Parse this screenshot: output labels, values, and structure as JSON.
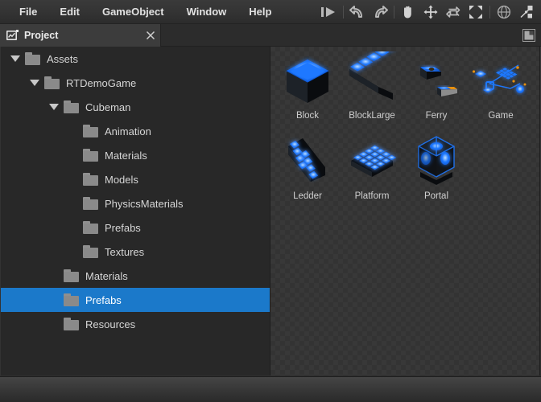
{
  "menubar": {
    "items": [
      {
        "label": "File"
      },
      {
        "label": "Edit"
      },
      {
        "label": "GameObject"
      },
      {
        "label": "Window"
      },
      {
        "label": "Help"
      }
    ],
    "toolbar": [
      {
        "name": "play-step-button",
        "icon": "play-step-icon"
      },
      {
        "name": "undo-button",
        "icon": "undo-icon"
      },
      {
        "name": "redo-button",
        "icon": "redo-icon"
      },
      {
        "name": "hand-tool-button",
        "icon": "hand-icon"
      },
      {
        "name": "move-tool-button",
        "icon": "move-arrows-icon"
      },
      {
        "name": "rotate-tool-button",
        "icon": "rotate-icon"
      },
      {
        "name": "scale-tool-button",
        "icon": "expand-arrows-icon"
      },
      {
        "name": "globe-button",
        "icon": "globe-icon"
      },
      {
        "name": "connect-button",
        "icon": "node-link-icon"
      }
    ]
  },
  "tabbar": {
    "tab_label": "Project",
    "tab_icon": "project-panel-icon",
    "close_icon": "close-icon",
    "panel_menu_icon": "panel-layout-icon"
  },
  "tree": {
    "items": [
      {
        "label": "Assets",
        "depth": 0,
        "expanded": true,
        "selected": false
      },
      {
        "label": "RTDemoGame",
        "depth": 1,
        "expanded": true,
        "selected": false
      },
      {
        "label": "Cubeman",
        "depth": 2,
        "expanded": true,
        "selected": false
      },
      {
        "label": "Animation",
        "depth": 3,
        "expanded": false,
        "selected": false
      },
      {
        "label": "Materials",
        "depth": 3,
        "expanded": false,
        "selected": false
      },
      {
        "label": "Models",
        "depth": 3,
        "expanded": false,
        "selected": false
      },
      {
        "label": "PhysicsMaterials",
        "depth": 3,
        "expanded": false,
        "selected": false
      },
      {
        "label": "Prefabs",
        "depth": 3,
        "expanded": false,
        "selected": false
      },
      {
        "label": "Textures",
        "depth": 3,
        "expanded": false,
        "selected": false
      },
      {
        "label": "Materials",
        "depth": 2,
        "expanded": false,
        "selected": false
      },
      {
        "label": "Prefabs",
        "depth": 2,
        "expanded": false,
        "selected": true
      },
      {
        "label": "Resources",
        "depth": 2,
        "expanded": false,
        "selected": false
      }
    ],
    "selection_color": "#1b79ca"
  },
  "grid": {
    "items": [
      {
        "label": "Block",
        "thumb": "block-cube-thumb"
      },
      {
        "label": "BlockLarge",
        "thumb": "block-large-thumb"
      },
      {
        "label": "Ferry",
        "thumb": "ferry-thumb"
      },
      {
        "label": "Game",
        "thumb": "game-scene-thumb"
      },
      {
        "label": "Ledder",
        "thumb": "ledder-thumb"
      },
      {
        "label": "Platform",
        "thumb": "platform-thumb"
      },
      {
        "label": "Portal",
        "thumb": "portal-thumb"
      }
    ]
  },
  "colors": {
    "accent_blue": "#1e78ff",
    "selection_blue": "#1b79ca",
    "panel_bg": "#282828",
    "checker_a": "#383838",
    "checker_b": "#333333",
    "gold": "#e8900e"
  }
}
